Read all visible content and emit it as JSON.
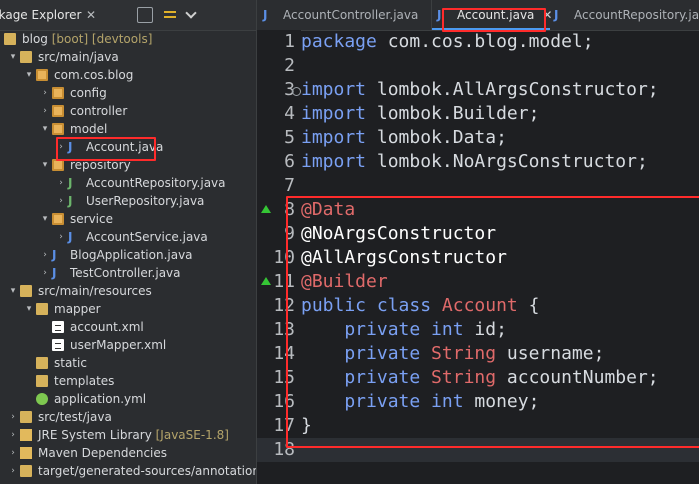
{
  "left_panel": {
    "title": "ckage Explorer",
    "close": "✕",
    "tree": [
      {
        "indent": 0,
        "twisty": "▾",
        "icon": "folder-icon",
        "label": "blog",
        "extra": "[boot] [devtools]"
      },
      {
        "indent": 1,
        "twisty": "▾",
        "icon": "folder-icon",
        "label": "src/main/java"
      },
      {
        "indent": 2,
        "twisty": "▾",
        "icon": "package-icon",
        "label": "com.cos.blog"
      },
      {
        "indent": 3,
        "twisty": "›",
        "icon": "package-icon",
        "label": "config"
      },
      {
        "indent": 3,
        "twisty": "›",
        "icon": "package-icon",
        "label": "controller"
      },
      {
        "indent": 3,
        "twisty": "▾",
        "icon": "package-icon",
        "label": "model"
      },
      {
        "indent": 4,
        "twisty": "›",
        "icon": "java-class-icon",
        "label": "Account.java",
        "highlight": true
      },
      {
        "indent": 3,
        "twisty": "▾",
        "icon": "package-icon",
        "label": "repository"
      },
      {
        "indent": 4,
        "twisty": "›",
        "icon": "java-interface-icon",
        "label": "AccountRepository.java"
      },
      {
        "indent": 4,
        "twisty": "›",
        "icon": "java-interface-icon",
        "label": "UserRepository.java"
      },
      {
        "indent": 3,
        "twisty": "▾",
        "icon": "package-icon",
        "label": "service"
      },
      {
        "indent": 4,
        "twisty": "›",
        "icon": "java-class-icon",
        "label": "AccountService.java"
      },
      {
        "indent": 3,
        "twisty": "›",
        "icon": "java-class-icon",
        "label": "BlogApplication.java"
      },
      {
        "indent": 3,
        "twisty": "›",
        "icon": "java-class-icon",
        "label": "TestController.java"
      },
      {
        "indent": 1,
        "twisty": "▾",
        "icon": "folder-icon",
        "label": "src/main/resources"
      },
      {
        "indent": 2,
        "twisty": "▾",
        "icon": "folder-icon",
        "label": "mapper"
      },
      {
        "indent": 3,
        "twisty": "",
        "icon": "xml-file-icon",
        "label": "account.xml"
      },
      {
        "indent": 3,
        "twisty": "",
        "icon": "xml-file-icon",
        "label": "userMapper.xml"
      },
      {
        "indent": 2,
        "twisty": "",
        "icon": "folder-icon",
        "label": "static"
      },
      {
        "indent": 2,
        "twisty": "",
        "icon": "folder-icon",
        "label": "templates"
      },
      {
        "indent": 2,
        "twisty": "",
        "icon": "yaml-file-icon",
        "label": "application.yml"
      },
      {
        "indent": 1,
        "twisty": "›",
        "icon": "folder-icon",
        "label": "src/test/java"
      },
      {
        "indent": 1,
        "twisty": "›",
        "icon": "library-icon",
        "label": "JRE System Library",
        "extra": "[JavaSE-1.8]"
      },
      {
        "indent": 1,
        "twisty": "›",
        "icon": "library-icon",
        "label": "Maven Dependencies"
      },
      {
        "indent": 1,
        "twisty": "›",
        "icon": "folder-icon",
        "label": "target/generated-sources/annotations"
      }
    ]
  },
  "editor": {
    "tabs": [
      {
        "label": "AccountController.java",
        "active": false
      },
      {
        "label": "Account.java",
        "active": true,
        "close": "✕"
      },
      {
        "label": "AccountRepository.java",
        "active": false
      }
    ],
    "line_numbers": [
      "1",
      "2",
      "3",
      "4",
      "5",
      "6",
      "7",
      "8",
      "9",
      "10",
      "11",
      "12",
      "13",
      "14",
      "15",
      "16",
      "17",
      "18"
    ],
    "code": {
      "l1": [
        "package",
        " com.cos.blog.model;"
      ],
      "l3": [
        "import",
        " lombok.AllArgsConstructor;"
      ],
      "l4": [
        "import",
        " lombok.Builder;"
      ],
      "l5": [
        "import",
        " lombok.Data;"
      ],
      "l6": [
        "import",
        " lombok.NoArgsConstructor;"
      ],
      "l8": "@Data",
      "l9": "@NoArgsConstructor",
      "l10": "@AllArgsConstructor",
      "l11": "@Builder",
      "l12": [
        "public",
        " class",
        " Account",
        " {"
      ],
      "l13": [
        "    private",
        " int",
        " id;"
      ],
      "l14": [
        "    private",
        " String",
        " username;"
      ],
      "l15": [
        "    private",
        " String",
        " accountNumber;"
      ],
      "l16": [
        "    private",
        " int",
        " money;"
      ],
      "l17": "}"
    }
  },
  "colors": {
    "keyword": "#7aa0f3",
    "annotation": "#e06a6a",
    "highlight_box": "#ff2b2b",
    "active_tab": "#4c9bf1"
  }
}
